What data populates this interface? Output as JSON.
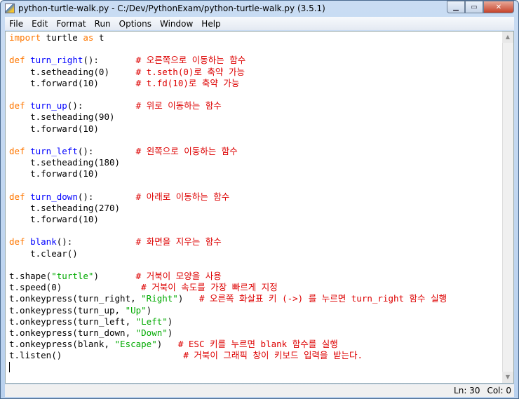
{
  "window": {
    "title": "python-turtle-walk.py - C:/Dev/PythonExam/python-turtle-walk.py (3.5.1)"
  },
  "menu": [
    "File",
    "Edit",
    "Format",
    "Run",
    "Options",
    "Window",
    "Help"
  ],
  "status": {
    "line": "Ln: 30",
    "col": "Col: 0"
  },
  "colors": {
    "keyword": "#ff7700",
    "definition": "#0000ff",
    "comment": "#dd0000",
    "string": "#00aa00"
  },
  "code": {
    "lines": [
      [
        {
          "t": "kw",
          "s": "import"
        },
        {
          "t": "",
          "s": " turtle "
        },
        {
          "t": "kw",
          "s": "as"
        },
        {
          "t": "",
          "s": " t"
        }
      ],
      [],
      [
        {
          "t": "kw",
          "s": "def"
        },
        {
          "t": "",
          "s": " "
        },
        {
          "t": "def",
          "s": "turn_right"
        },
        {
          "t": "",
          "s": "():       "
        },
        {
          "t": "cm",
          "s": "# 오른쪽으로 이동하는 함수"
        }
      ],
      [
        {
          "t": "",
          "s": "    t.setheading(0)     "
        },
        {
          "t": "cm",
          "s": "# t.seth(0)로 축약 가능"
        }
      ],
      [
        {
          "t": "",
          "s": "    t.forward(10)       "
        },
        {
          "t": "cm",
          "s": "# t.fd(10)로 축약 가능"
        }
      ],
      [],
      [
        {
          "t": "kw",
          "s": "def"
        },
        {
          "t": "",
          "s": " "
        },
        {
          "t": "def",
          "s": "turn_up"
        },
        {
          "t": "",
          "s": "():          "
        },
        {
          "t": "cm",
          "s": "# 위로 이동하는 함수"
        }
      ],
      [
        {
          "t": "",
          "s": "    t.setheading(90)"
        }
      ],
      [
        {
          "t": "",
          "s": "    t.forward(10)"
        }
      ],
      [],
      [
        {
          "t": "kw",
          "s": "def"
        },
        {
          "t": "",
          "s": " "
        },
        {
          "t": "def",
          "s": "turn_left"
        },
        {
          "t": "",
          "s": "():        "
        },
        {
          "t": "cm",
          "s": "# 왼쪽으로 이동하는 함수"
        }
      ],
      [
        {
          "t": "",
          "s": "    t.setheading(180)"
        }
      ],
      [
        {
          "t": "",
          "s": "    t.forward(10)"
        }
      ],
      [],
      [
        {
          "t": "kw",
          "s": "def"
        },
        {
          "t": "",
          "s": " "
        },
        {
          "t": "def",
          "s": "turn_down"
        },
        {
          "t": "",
          "s": "():        "
        },
        {
          "t": "cm",
          "s": "# 아래로 이동하는 함수"
        }
      ],
      [
        {
          "t": "",
          "s": "    t.setheading(270)"
        }
      ],
      [
        {
          "t": "",
          "s": "    t.forward(10)"
        }
      ],
      [],
      [
        {
          "t": "kw",
          "s": "def"
        },
        {
          "t": "",
          "s": " "
        },
        {
          "t": "def",
          "s": "blank"
        },
        {
          "t": "",
          "s": "():            "
        },
        {
          "t": "cm",
          "s": "# 화면을 지우는 함수"
        }
      ],
      [
        {
          "t": "",
          "s": "    t.clear()"
        }
      ],
      [],
      [
        {
          "t": "",
          "s": "t.shape("
        },
        {
          "t": "st",
          "s": "\"turtle\""
        },
        {
          "t": "",
          "s": ")       "
        },
        {
          "t": "cm",
          "s": "# 거북이 모양을 사용"
        }
      ],
      [
        {
          "t": "",
          "s": "t.speed(0)               "
        },
        {
          "t": "cm",
          "s": "# 거북이 속도를 가장 빠르게 지정"
        }
      ],
      [
        {
          "t": "",
          "s": "t.onkeypress(turn_right, "
        },
        {
          "t": "st",
          "s": "\"Right\""
        },
        {
          "t": "",
          "s": ")   "
        },
        {
          "t": "cm",
          "s": "# 오른쪽 화살표 키 (->) 를 누르면 turn_right 함수 실행"
        }
      ],
      [
        {
          "t": "",
          "s": "t.onkeypress(turn_up, "
        },
        {
          "t": "st",
          "s": "\"Up\""
        },
        {
          "t": "",
          "s": ")"
        }
      ],
      [
        {
          "t": "",
          "s": "t.onkeypress(turn_left, "
        },
        {
          "t": "st",
          "s": "\"Left\""
        },
        {
          "t": "",
          "s": ")"
        }
      ],
      [
        {
          "t": "",
          "s": "t.onkeypress(turn_down, "
        },
        {
          "t": "st",
          "s": "\"Down\""
        },
        {
          "t": "",
          "s": ")"
        }
      ],
      [
        {
          "t": "",
          "s": "t.onkeypress(blank, "
        },
        {
          "t": "st",
          "s": "\"Escape\""
        },
        {
          "t": "",
          "s": ")   "
        },
        {
          "t": "cm",
          "s": "# ESC 키를 누르면 blank 함수를 실행"
        }
      ],
      [
        {
          "t": "",
          "s": "t.listen()                       "
        },
        {
          "t": "cm",
          "s": "# 거북이 그래픽 창이 키보드 입력을 받는다."
        }
      ],
      []
    ]
  }
}
